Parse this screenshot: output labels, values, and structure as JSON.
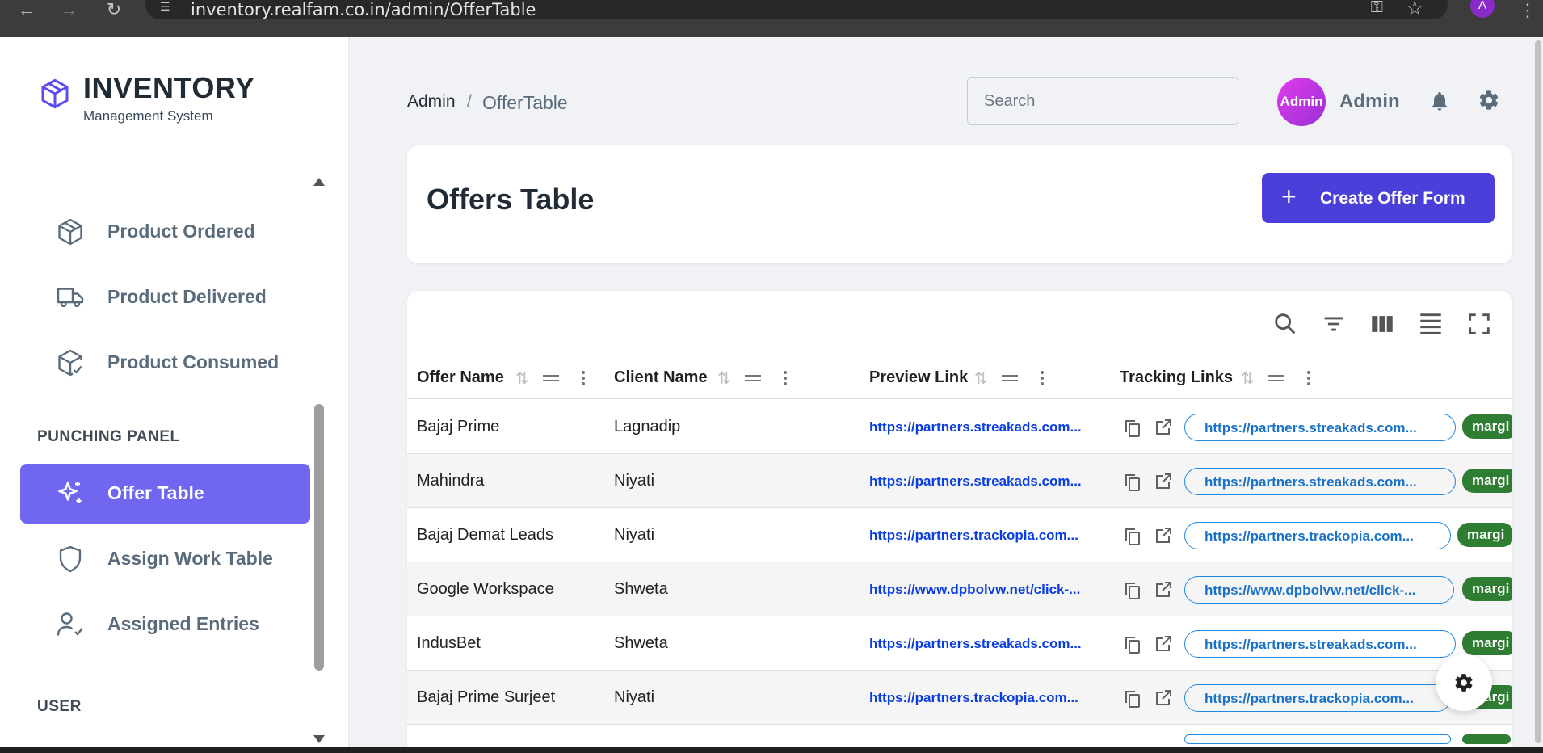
{
  "browser": {
    "url": "inventory.realfam.co.in/admin/OfferTable",
    "profile_initial": "A"
  },
  "brand": {
    "title": "INVENTORY",
    "subtitle": "Management System"
  },
  "sidebar": {
    "items": [
      {
        "label": "Product Ordered",
        "icon": "box-icon"
      },
      {
        "label": "Product Delivered",
        "icon": "truck-icon"
      },
      {
        "label": "Product Consumed",
        "icon": "package-check-icon"
      }
    ],
    "section_punching": "PUNCHING PANEL",
    "punching_items": [
      {
        "label": "Offer Table",
        "icon": "sparkles-icon",
        "active": true
      },
      {
        "label": "Assign Work Table",
        "icon": "shield-icon"
      },
      {
        "label": "Assigned Entries",
        "icon": "user-check-icon"
      }
    ],
    "section_user": "USER"
  },
  "header": {
    "breadcrumb": [
      "Admin",
      "OfferTable"
    ],
    "breadcrumb_separator": "/",
    "search_placeholder": "Search",
    "avatar_label": "Admin",
    "user_name": "Admin"
  },
  "offers": {
    "title": "Offers Table",
    "create_button": "Create Offer Form",
    "create_button_icon": "+"
  },
  "table": {
    "columns": [
      "Offer Name",
      "Client Name",
      "Preview Link",
      "Tracking Links"
    ],
    "rows": [
      {
        "offer": "Bajaj Prime",
        "client": "Lagnadip",
        "preview": "https://partners.streakads.com...",
        "tracking": "https://partners.streakads.com...",
        "tag": "margi"
      },
      {
        "offer": "Mahindra",
        "client": "Niyati",
        "preview": "https://partners.streakads.com...",
        "tracking": "https://partners.streakads.com...",
        "tag": "margi"
      },
      {
        "offer": "Bajaj Demat Leads",
        "client": "Niyati",
        "preview": "https://partners.trackopia.com...",
        "tracking": "https://partners.trackopia.com...",
        "tag": "margi"
      },
      {
        "offer": "Google Workspace",
        "client": "Shweta",
        "preview": "https://www.dpbolvw.net/click-...",
        "tracking": "https://www.dpbolvw.net/click-...",
        "tag": "margi"
      },
      {
        "offer": "IndusBet",
        "client": "Shweta",
        "preview": "https://partners.streakads.com...",
        "tracking": "https://partners.streakads.com...",
        "tag": "margi"
      },
      {
        "offer": "Bajaj Prime Surjeet",
        "client": "Niyati",
        "preview": "https://partners.trackopia.com...",
        "tracking": "https://partners.trackopia.com...",
        "tag": "margi"
      }
    ]
  },
  "colors": {
    "accent": "#7166f0",
    "primary_button": "#4a3fd8",
    "tag_green": "#2e7d32",
    "link_blue": "#0b3ee0"
  }
}
